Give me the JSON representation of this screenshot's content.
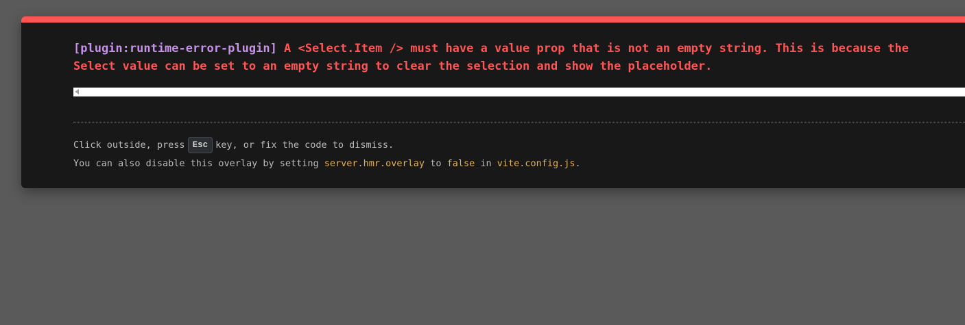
{
  "error": {
    "plugin_tag": "[plugin:runtime-error-plugin]",
    "message_line1": " A <Select.Item /> must have a value prop that is not an empty string. This is because the",
    "message_line2": "Select value can be set to an empty string to clear the selection and show the placeholder."
  },
  "tip": {
    "line1_prefix": "Click outside, press",
    "esc_key": "Esc",
    "line1_suffix": "key, or fix the code to dismiss.",
    "line2_part1": "You can also disable this overlay by setting ",
    "code_option": "server.hmr.overlay",
    "line2_part2": " to ",
    "code_value": "false",
    "line2_part3": " in ",
    "code_file": "vite.config.js",
    "line2_part4": "."
  },
  "colors": {
    "accent_bar": "#ff5555",
    "plugin_tag": "#c792ea",
    "error_text": "#ff5555",
    "code_highlight": "#e2b25a",
    "panel_bg": "#181818",
    "backdrop": "#5a5a5a"
  },
  "icons": {
    "scroll_left": "scroll-left-arrow-icon"
  }
}
